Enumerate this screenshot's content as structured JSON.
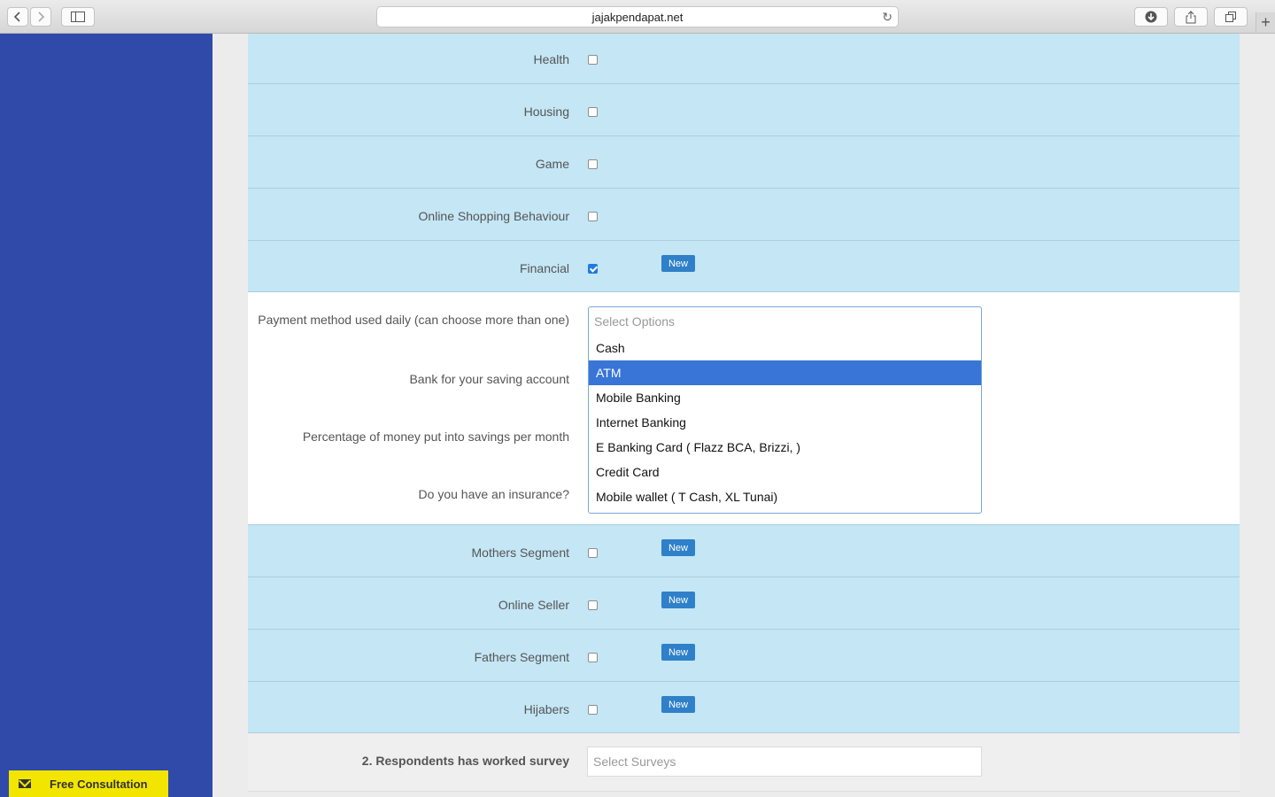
{
  "browser": {
    "url": "jajakpendapat.net",
    "reload_icon": "↻",
    "new_tab_icon": "+"
  },
  "categories": [
    {
      "label": "Health",
      "checked": false,
      "badge": ""
    },
    {
      "label": "Housing",
      "checked": false,
      "badge": ""
    },
    {
      "label": "Game",
      "checked": false,
      "badge": ""
    },
    {
      "label": "Online Shopping Behaviour",
      "checked": false,
      "badge": ""
    },
    {
      "label": "Financial",
      "checked": true,
      "badge": "New"
    }
  ],
  "financial_questions": {
    "payment_method": "Payment method used daily (can choose more than one)",
    "bank": "Bank for your saving account",
    "savings_pct": "Percentage of money put into savings per month",
    "insurance": "Do you have an insurance?"
  },
  "payment_dropdown": {
    "placeholder": "Select Options",
    "options": [
      "Cash",
      "ATM",
      "Mobile Banking",
      "Internet Banking",
      "E Banking Card ( Flazz BCA, Brizzi, )",
      "Credit Card",
      "Mobile wallet ( T Cash, XL Tunai)"
    ],
    "highlighted": "ATM"
  },
  "segments": [
    {
      "label": "Mothers Segment",
      "checked": false,
      "badge": "New"
    },
    {
      "label": "Online Seller",
      "checked": false,
      "badge": "New"
    },
    {
      "label": "Fathers Segment",
      "checked": false,
      "badge": "New"
    },
    {
      "label": "Hijabers",
      "checked": false,
      "badge": "New"
    }
  ],
  "survey_section": {
    "title": "2. Respondents has worked survey",
    "placeholder": "Select Surveys"
  },
  "consultation": {
    "label": "Free Consultation"
  }
}
